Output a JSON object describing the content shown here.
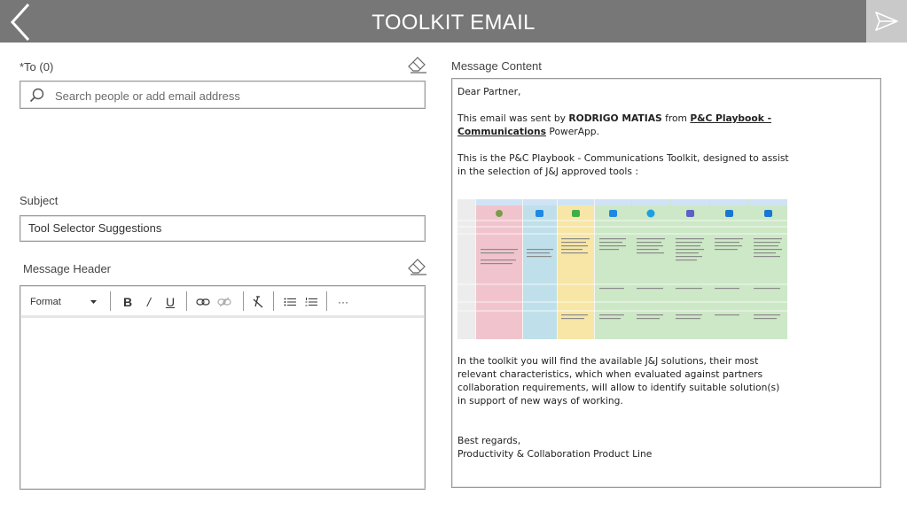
{
  "header": {
    "title": "TOOLKIT EMAIL"
  },
  "to": {
    "label": "*To (0)",
    "placeholder": "Search people or add email address"
  },
  "subject": {
    "label": "Subject",
    "value": "Tool Selector Suggestions"
  },
  "message_header": {
    "label": "Message Header"
  },
  "toolbar": {
    "format_label": "Format",
    "bold": "B",
    "italic": "/",
    "underline": "U",
    "more": "···"
  },
  "message_content": {
    "label": "Message Content",
    "greeting": "Dear Partner,",
    "sent_by_prefix": "This email was sent by ",
    "sender": "RODRIGO MATIAS",
    "from_text": " from ",
    "link_text": "P&C Playbook - Communications",
    "suffix": " PowerApp.",
    "intro": "This is the P&C Playbook - Communications Toolkit, designed to assist in the selection of J&J approved tools :",
    "body": "In the toolkit you will find the available J&J solutions, their most relevant characteristics, which when evaluated against partners collaboration requirements, will allow to identify suitable solution(s) in support of new ways of working.",
    "regards": "Best regards,",
    "signature": "Productivity & Collaboration Product Line"
  },
  "colors": {
    "header_bg": "#777777",
    "send_bg": "#c9c9c9",
    "border": "#9a9a9a"
  },
  "icons": [
    "back-arrow-icon",
    "send-icon",
    "eraser-icon",
    "search-icon",
    "link-icon",
    "unlink-icon",
    "clear-format-icon",
    "bullet-list-icon",
    "numbered-list-icon",
    "more-icon"
  ]
}
